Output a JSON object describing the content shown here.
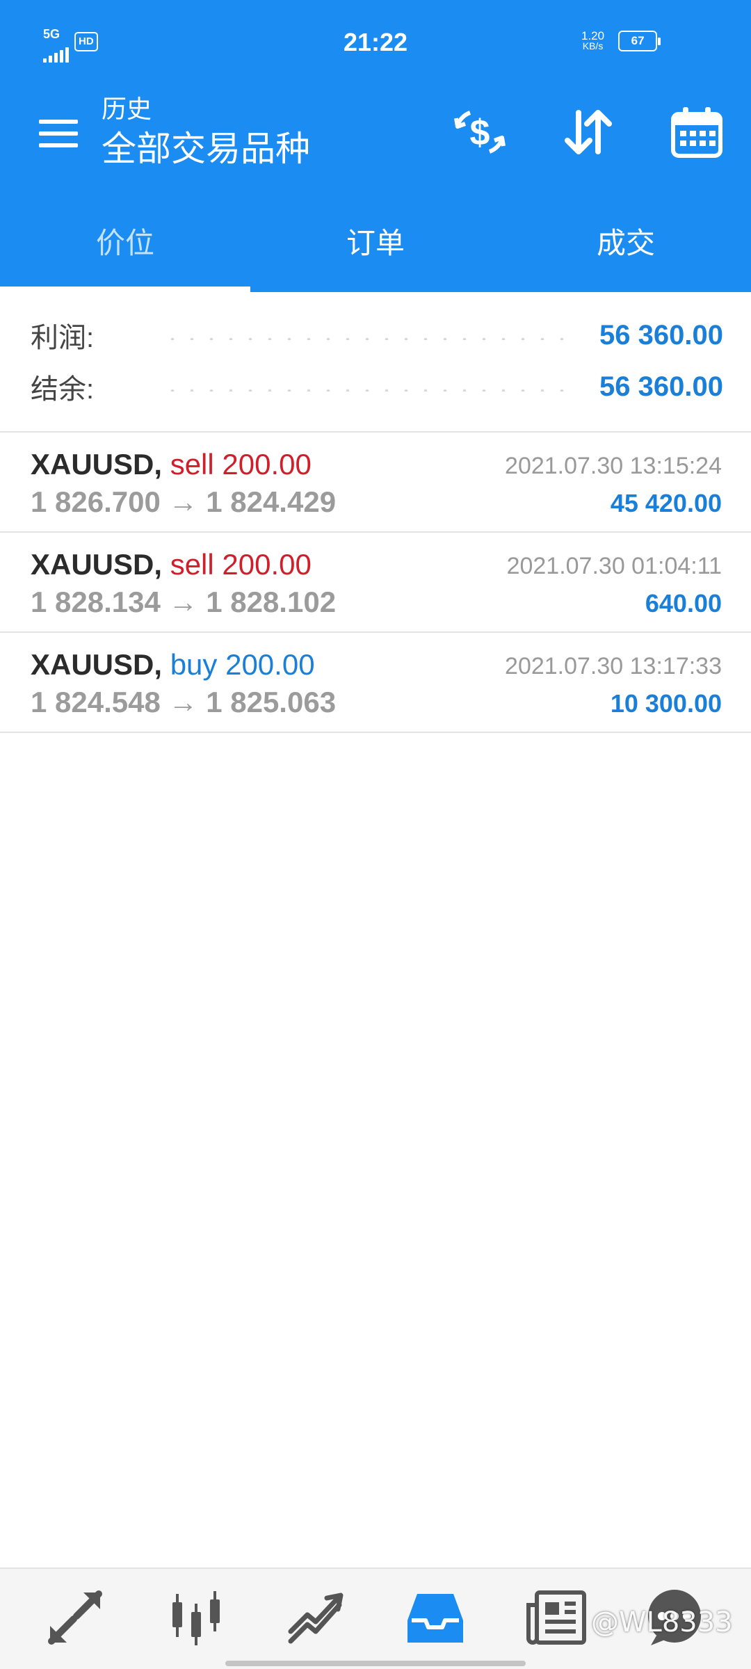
{
  "status_bar": {
    "network": "5G",
    "hd": "HD",
    "time": "21:22",
    "speed_value": "1.20",
    "speed_unit": "KB/s",
    "battery": "67"
  },
  "header": {
    "subtitle": "历史",
    "title": "全部交易品种"
  },
  "tabs": [
    {
      "label": "价位",
      "active": true
    },
    {
      "label": "订单",
      "active": false
    },
    {
      "label": "成交",
      "active": false
    }
  ],
  "summary": {
    "profit_label": "利润:",
    "profit_value": "56 360.00",
    "balance_label": "结余:",
    "balance_value": "56 360.00"
  },
  "trades": [
    {
      "symbol": "XAUUSD,",
      "side": "sell",
      "volume": "200.00",
      "open": "1 826.700",
      "arrow": "→",
      "close": "1 824.429",
      "time": "2021.07.30 13:15:24",
      "profit": "45 420.00"
    },
    {
      "symbol": "XAUUSD,",
      "side": "sell",
      "volume": "200.00",
      "open": "1 828.134",
      "arrow": "→",
      "close": "1 828.102",
      "time": "2021.07.30 01:04:11",
      "profit": "640.00"
    },
    {
      "symbol": "XAUUSD,",
      "side": "buy",
      "volume": "200.00",
      "open": "1 824.548",
      "arrow": "→",
      "close": "1 825.063",
      "time": "2021.07.30 13:17:33",
      "profit": "10 300.00"
    }
  ],
  "bottom_nav": [
    {
      "icon": "quotes-icon"
    },
    {
      "icon": "chart-candles-icon"
    },
    {
      "icon": "trade-icon"
    },
    {
      "icon": "history-inbox-icon",
      "active": true
    },
    {
      "icon": "news-icon"
    },
    {
      "icon": "messages-icon"
    }
  ],
  "watermark": "@WL8333",
  "colors": {
    "primary": "#1a8cf2",
    "sell": "#d01f2a",
    "buy": "#1a7fd8",
    "profit": "#1a7fd8"
  }
}
